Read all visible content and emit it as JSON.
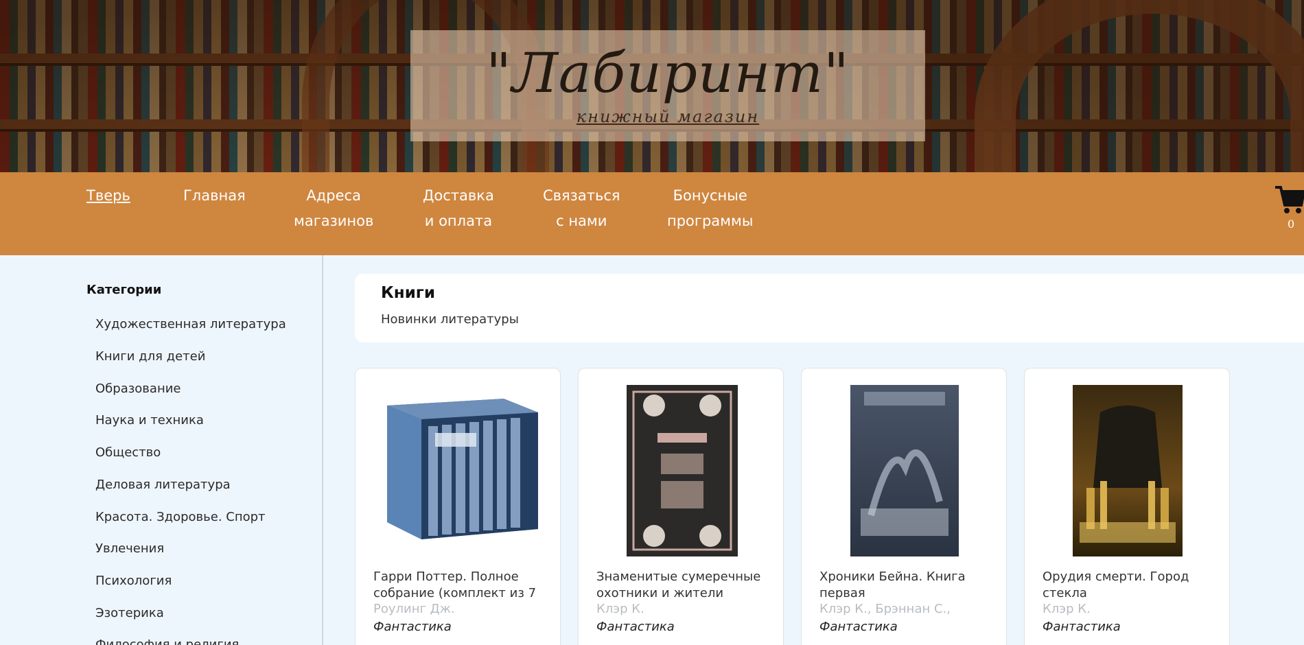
{
  "header": {
    "logo_title": "\"Лабиринт\"",
    "logo_subtitle": "книжный магазин"
  },
  "nav": {
    "items": [
      {
        "line1": "Тверь",
        "line2": ""
      },
      {
        "line1": "Главная",
        "line2": ""
      },
      {
        "line1": "Адреса",
        "line2": "магазинов"
      },
      {
        "line1": "Доставка",
        "line2": "и оплата"
      },
      {
        "line1": "Связаться",
        "line2": "с нами"
      },
      {
        "line1": "Бонусные",
        "line2": "программы"
      }
    ],
    "cart_icon": "cart-icon",
    "cart_count": "0"
  },
  "sidebar": {
    "title": "Категории",
    "items": [
      "Художественная литература",
      "Книги для детей",
      "Образование",
      "Наука и техника",
      "Общество",
      "Деловая литература",
      "Красота. Здоровье. Спорт",
      "Увлечения",
      "Психология",
      "Эзотерика",
      "Философия и религия"
    ]
  },
  "main": {
    "title": "Книги",
    "subtitle": "Новинки литературы",
    "books": [
      {
        "title": "Гарри Поттер. Полное собрание (комплект из 7",
        "author": "Роулинг Дж.",
        "genre": "Фантастика"
      },
      {
        "title": "Знаменитые сумеречные охотники и жители",
        "author": "Клэр К.",
        "genre": "Фантастика"
      },
      {
        "title": "Хроники Бейна. Книга первая",
        "author": "Клэр К., Брэннан С.,",
        "genre": "Фантастика"
      },
      {
        "title": "Орудия смерти. Город стекла",
        "author": "Клэр К.",
        "genre": "Фантастика"
      }
    ]
  },
  "colors": {
    "nav_bg": "#cf863f",
    "page_bg": "#eef6fd"
  }
}
